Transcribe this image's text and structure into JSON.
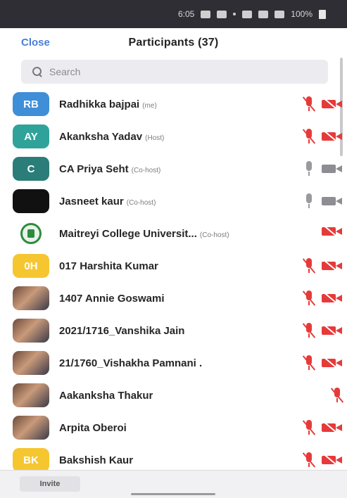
{
  "status_bar": {
    "time": "6:05",
    "battery": "100%"
  },
  "header": {
    "close_label": "Close",
    "title": "Participants (37)"
  },
  "search": {
    "placeholder": "Search"
  },
  "participants": [
    {
      "initials": "RB",
      "avatar_color": "#3f8ed8",
      "avatar_type": "initials",
      "name": "Radhikka bajpai",
      "role": "(me)",
      "mic": "muted",
      "video": "off"
    },
    {
      "initials": "AY",
      "avatar_color": "#2fa39a",
      "avatar_type": "initials",
      "name": "Akanksha Yadav",
      "role": "(Host)",
      "mic": "muted",
      "video": "off"
    },
    {
      "initials": "C",
      "avatar_color": "#2a7d79",
      "avatar_type": "initials",
      "name": "CA Priya Seht",
      "role": "(Co-host)",
      "mic": "on",
      "video": "on"
    },
    {
      "initials": "",
      "avatar_color": "#111111",
      "avatar_type": "initials",
      "name": "Jasneet kaur",
      "role": "(Co-host)",
      "mic": "on",
      "video": "on"
    },
    {
      "initials": "",
      "avatar_color": "#ffffff",
      "avatar_type": "logo",
      "name": "Maitreyi College Universit...",
      "role": "(Co-host)",
      "mic": "none",
      "video": "off"
    },
    {
      "initials": "0H",
      "avatar_color": "#f6c630",
      "avatar_type": "initials",
      "name": "017 Harshita Kumar",
      "role": "",
      "mic": "muted",
      "video": "off"
    },
    {
      "initials": "",
      "avatar_color": "#8a5a3a",
      "avatar_type": "photo",
      "name": "1407 Annie Goswami",
      "role": "",
      "mic": "muted",
      "video": "off"
    },
    {
      "initials": "",
      "avatar_color": "#7a5a4a",
      "avatar_type": "photo",
      "name": "2021/1716_Vanshika Jain",
      "role": "",
      "mic": "muted",
      "video": "off"
    },
    {
      "initials": "",
      "avatar_color": "#4a4a6a",
      "avatar_type": "photo",
      "name": "21/1760_Vishakha Pamnani .",
      "role": "",
      "mic": "muted",
      "video": "off"
    },
    {
      "initials": "",
      "avatar_color": "#3a3a3a",
      "avatar_type": "photo",
      "name": "Aakanksha Thakur",
      "role": "",
      "mic": "muted",
      "video": "none"
    },
    {
      "initials": "",
      "avatar_color": "#a07a5a",
      "avatar_type": "photo",
      "name": "Arpita Oberoi",
      "role": "",
      "mic": "muted",
      "video": "off"
    },
    {
      "initials": "BK",
      "avatar_color": "#f6c630",
      "avatar_type": "initials",
      "name": "Bakshish Kaur",
      "role": "",
      "mic": "muted",
      "video": "off"
    }
  ],
  "footer": {
    "invite_label": "Invite"
  }
}
